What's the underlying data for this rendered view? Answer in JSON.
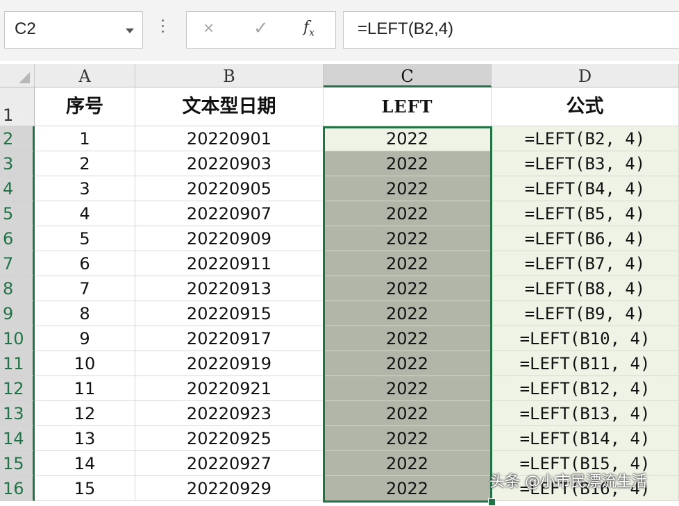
{
  "name_box": {
    "value": "C2"
  },
  "formula_bar": {
    "cancel_icon": "×",
    "enter_icon": "✓",
    "fx_label": "f",
    "fx_sub": "x",
    "formula": "=LEFT(B2,4)"
  },
  "columns": [
    "A",
    "B",
    "C",
    "D"
  ],
  "selected_column": "C",
  "header_row": {
    "row_number": "1",
    "cells": [
      "序号",
      "文本型日期",
      "LEFT",
      "公式"
    ]
  },
  "rows": [
    {
      "row_number": "2",
      "cells": [
        "1",
        "20220901",
        "2022",
        "=LEFT(B2, 4)"
      ]
    },
    {
      "row_number": "3",
      "cells": [
        "2",
        "20220903",
        "2022",
        "=LEFT(B3, 4)"
      ]
    },
    {
      "row_number": "4",
      "cells": [
        "3",
        "20220905",
        "2022",
        "=LEFT(B4, 4)"
      ]
    },
    {
      "row_number": "5",
      "cells": [
        "4",
        "20220907",
        "2022",
        "=LEFT(B5, 4)"
      ]
    },
    {
      "row_number": "6",
      "cells": [
        "5",
        "20220909",
        "2022",
        "=LEFT(B6, 4)"
      ]
    },
    {
      "row_number": "7",
      "cells": [
        "6",
        "20220911",
        "2022",
        "=LEFT(B7, 4)"
      ]
    },
    {
      "row_number": "8",
      "cells": [
        "7",
        "20220913",
        "2022",
        "=LEFT(B8, 4)"
      ]
    },
    {
      "row_number": "9",
      "cells": [
        "8",
        "20220915",
        "2022",
        "=LEFT(B9, 4)"
      ]
    },
    {
      "row_number": "10",
      "cells": [
        "9",
        "20220917",
        "2022",
        "=LEFT(B10, 4)"
      ]
    },
    {
      "row_number": "11",
      "cells": [
        "10",
        "20220919",
        "2022",
        "=LEFT(B11, 4)"
      ]
    },
    {
      "row_number": "12",
      "cells": [
        "11",
        "20220921",
        "2022",
        "=LEFT(B12, 4)"
      ]
    },
    {
      "row_number": "13",
      "cells": [
        "12",
        "20220923",
        "2022",
        "=LEFT(B13, 4)"
      ]
    },
    {
      "row_number": "14",
      "cells": [
        "13",
        "20220925",
        "2022",
        "=LEFT(B14, 4)"
      ]
    },
    {
      "row_number": "15",
      "cells": [
        "14",
        "20220927",
        "2022",
        "=LEFT(B15, 4)"
      ]
    },
    {
      "row_number": "16",
      "cells": [
        "15",
        "20220929",
        "2022",
        "=LEFT(B16, 4)"
      ]
    }
  ],
  "watermark": "头条 @小市民漂流生活",
  "colors": {
    "accent": "#217346",
    "selection_fill": "#b1b6a8",
    "formula_col_fill": "#eef3e6"
  }
}
